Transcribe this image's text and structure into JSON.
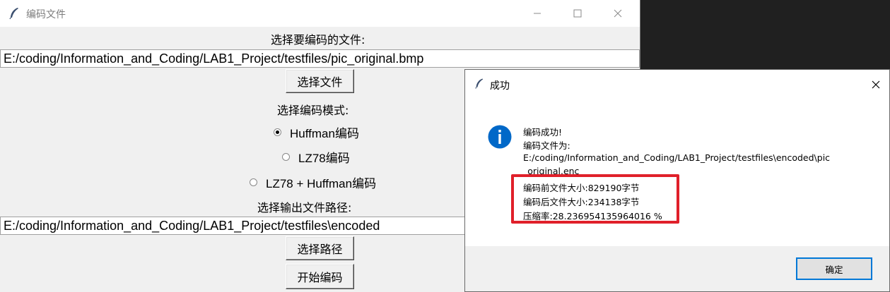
{
  "main_window": {
    "title": "编码文件",
    "input_label": "选择要编码的文件:",
    "input_path": "E:/coding/Information_and_Coding/LAB1_Project/testfiles/pic_original.bmp",
    "select_file_button": "选择文件",
    "mode_label": "选择编码模式:",
    "modes": [
      {
        "label": "Huffman编码",
        "selected": true
      },
      {
        "label": "LZ78编码",
        "selected": false
      },
      {
        "label": "LZ78 + Huffman编码",
        "selected": false
      }
    ],
    "output_label": "选择输出文件路径:",
    "output_path": "E:/coding/Information_and_Coding/LAB1_Project/testfiles\\encoded",
    "select_path_button": "选择路径",
    "start_button": "开始编码"
  },
  "dialog": {
    "title": "成功",
    "lines": [
      "编码成功!",
      "编码文件为:",
      "E:/coding/Information_and_Coding/LAB1_Project/testfiles\\encoded\\pic",
      "_original.enc",
      "编码前文件大小:829190字节",
      "编码后文件大小:234138字节",
      "压缩率:28.236954135964016 %"
    ],
    "ok_button": "确定",
    "highlight_color": "#e0202a",
    "accent_color": "#0078d7"
  }
}
